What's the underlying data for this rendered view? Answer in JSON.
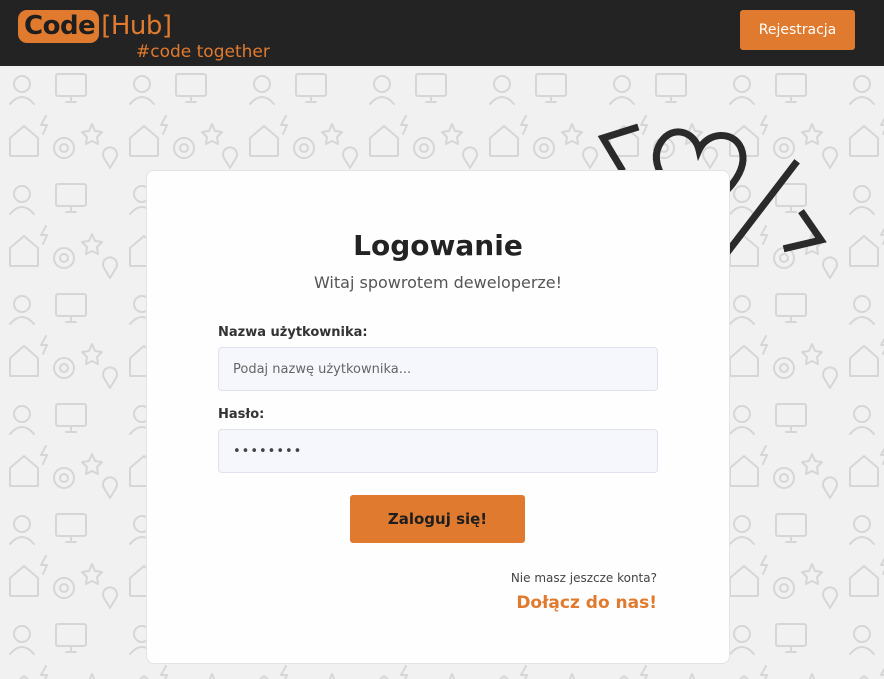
{
  "header": {
    "logo_code": "Code",
    "logo_hub": "[Hub]",
    "tagline": "#code together",
    "register_label": "Rejestracja"
  },
  "colors": {
    "accent": "#e07a2e",
    "header_bg": "#232323",
    "input_bg": "#f5f7fc"
  },
  "login": {
    "title": "Logowanie",
    "subtitle": "Witaj spowrotem deweloperze!",
    "username_label": "Nazwa użytkownika:",
    "username_placeholder": "Podaj nazwę użytkownika...",
    "username_value": "",
    "password_label": "Hasło:",
    "password_value": "••••••••",
    "submit_label": "Zaloguj się!",
    "no_account_text": "Nie masz jeszcze konta?",
    "join_link": "Dołącz do nas!"
  },
  "decoration": {
    "icon": "code-heart-icon"
  }
}
